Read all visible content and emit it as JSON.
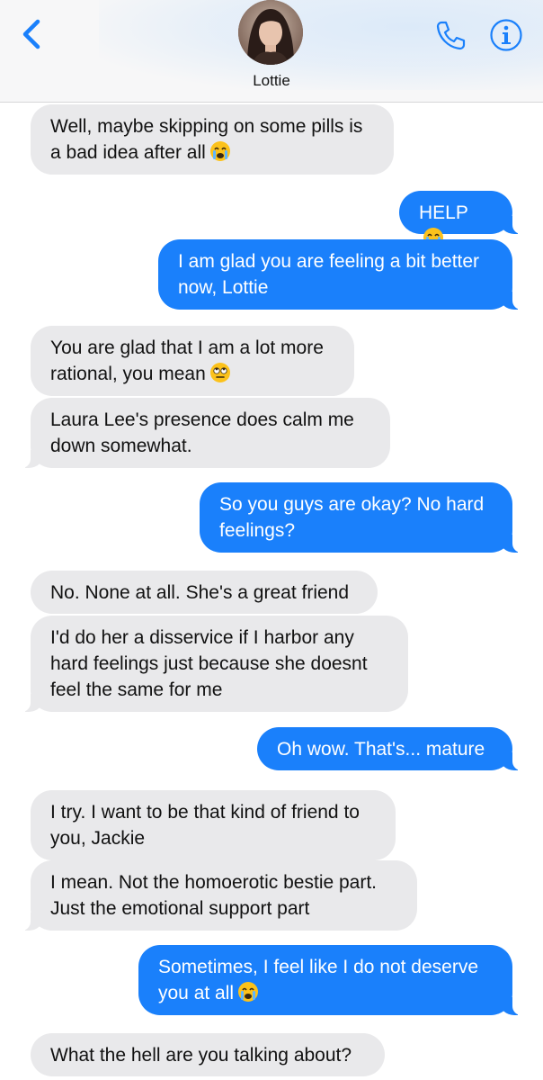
{
  "header": {
    "contact_name": "Lottie",
    "back_icon": "chevron-left-icon",
    "call_icon": "phone-icon",
    "info_icon": "info-icon",
    "accent_color": "#1a80fb"
  },
  "messages": [
    {
      "from": "contact",
      "text": "Well, maybe skipping on some pills is a bad idea after all",
      "emoji": "crying-face"
    },
    {
      "from": "me",
      "text": "HELP",
      "emoji": "crying-face"
    },
    {
      "from": "me",
      "text": "I am glad you are feeling a bit better now, Lottie"
    },
    {
      "from": "contact",
      "text": "You are glad that I am a lot more rational, you mean",
      "emoji": "eye-roll-face"
    },
    {
      "from": "contact",
      "text": "Laura Lee's presence does calm me down somewhat."
    },
    {
      "from": "me",
      "text": "So you guys are okay? No hard feelings?"
    },
    {
      "from": "contact",
      "text": "No. None at all. She's a great friend"
    },
    {
      "from": "contact",
      "text": "I'd do her a disservice if I harbor any hard feelings just because she doesnt feel the same for me"
    },
    {
      "from": "me",
      "text": "Oh wow. That's... mature"
    },
    {
      "from": "contact",
      "text": "I try. I want to be that kind of friend to you, Jackie"
    },
    {
      "from": "contact",
      "text": "I mean. Not the homoerotic bestie part. Just the emotional support part"
    },
    {
      "from": "me",
      "text": "Sometimes, I feel like I do not deserve you at all",
      "emoji": "crying-face"
    },
    {
      "from": "contact",
      "text": "What the hell are you talking about?"
    }
  ]
}
